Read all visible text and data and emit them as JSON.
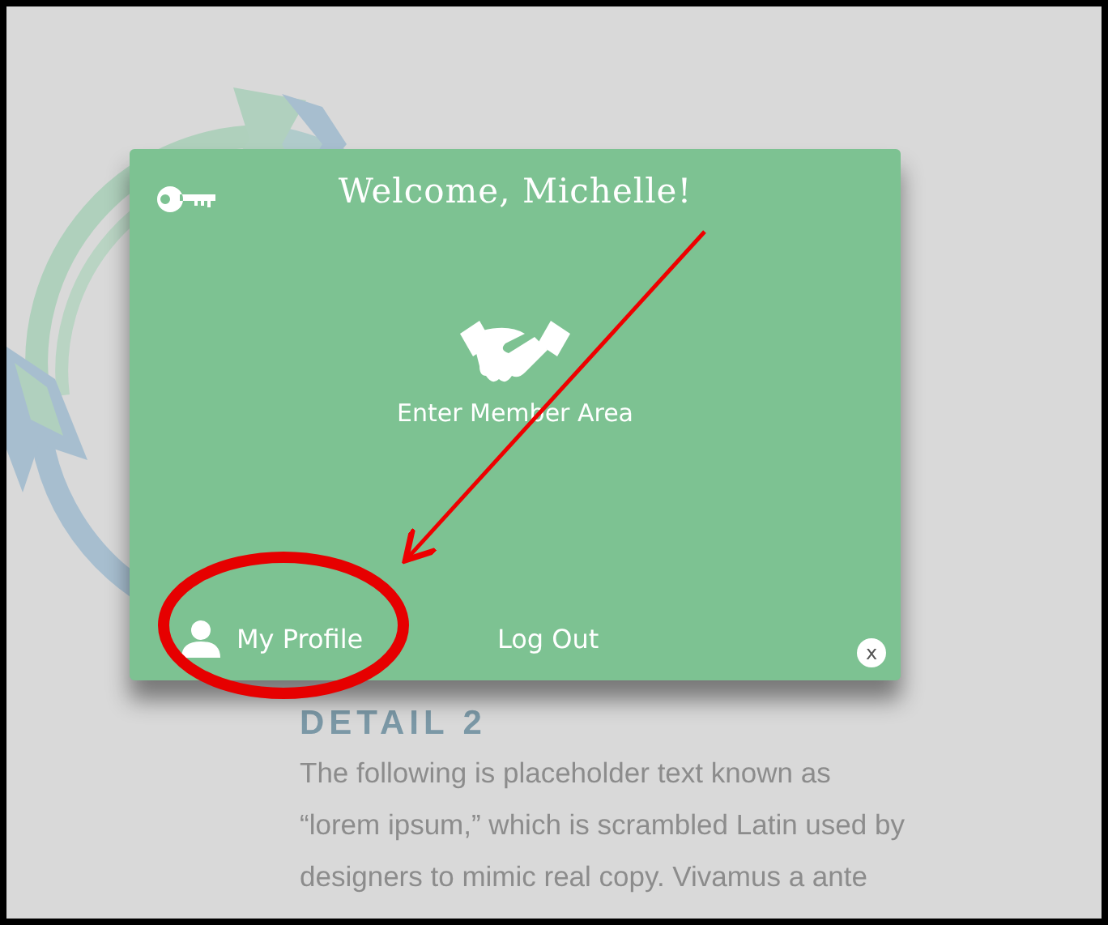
{
  "background_page": {
    "heading": "DETAIL 2",
    "paragraph": "The following is placeholder text known as\n“lorem ipsum,” which is scrambled Latin used by\ndesigners to mimic real copy. Vivamus a ante"
  },
  "member_popup": {
    "title": "Welcome, Michelle!",
    "member_area_link": "Enter Member Area",
    "footer_links": [
      {
        "kind": "profile",
        "label": "My Profile"
      },
      {
        "kind": "logout",
        "label": "Log Out"
      }
    ],
    "close_button": "x"
  }
}
